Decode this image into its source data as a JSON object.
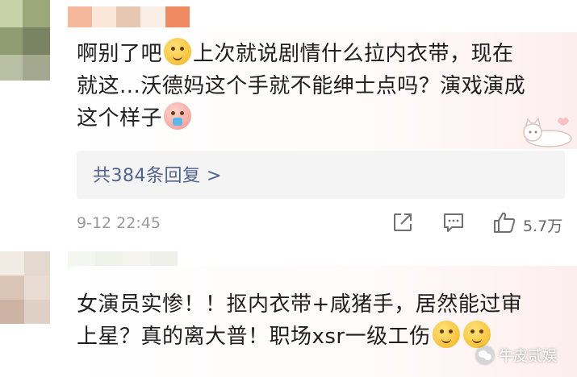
{
  "comment_1": {
    "text_line1_a": "啊别了吧",
    "text_line1_b": "上次就说剧情什么拉内衣带，现在",
    "text_line2": "就这...沃德妈这个手就不能绅士点吗？演戏演成",
    "text_line3": "这个样子",
    "emoji_1": "smirk-emoji",
    "emoji_2": "spitting-emoji",
    "reply_link": "共384条回复 >",
    "timestamp": "9-12 22:45",
    "like_count": "5.7万"
  },
  "comment_2": {
    "text_line1": "女演员实惨！！抠内衣带+咸猪手，居然能过审",
    "text_line2": "上星？真的离大普！职场xsr一级工伤",
    "emoji": "confused-emoji"
  },
  "watermark": {
    "text": "牛皮贰娱"
  },
  "colors": {
    "link": "#50638e",
    "meta": "#9a9a9a",
    "reply_bg": "#f4f4f4"
  }
}
